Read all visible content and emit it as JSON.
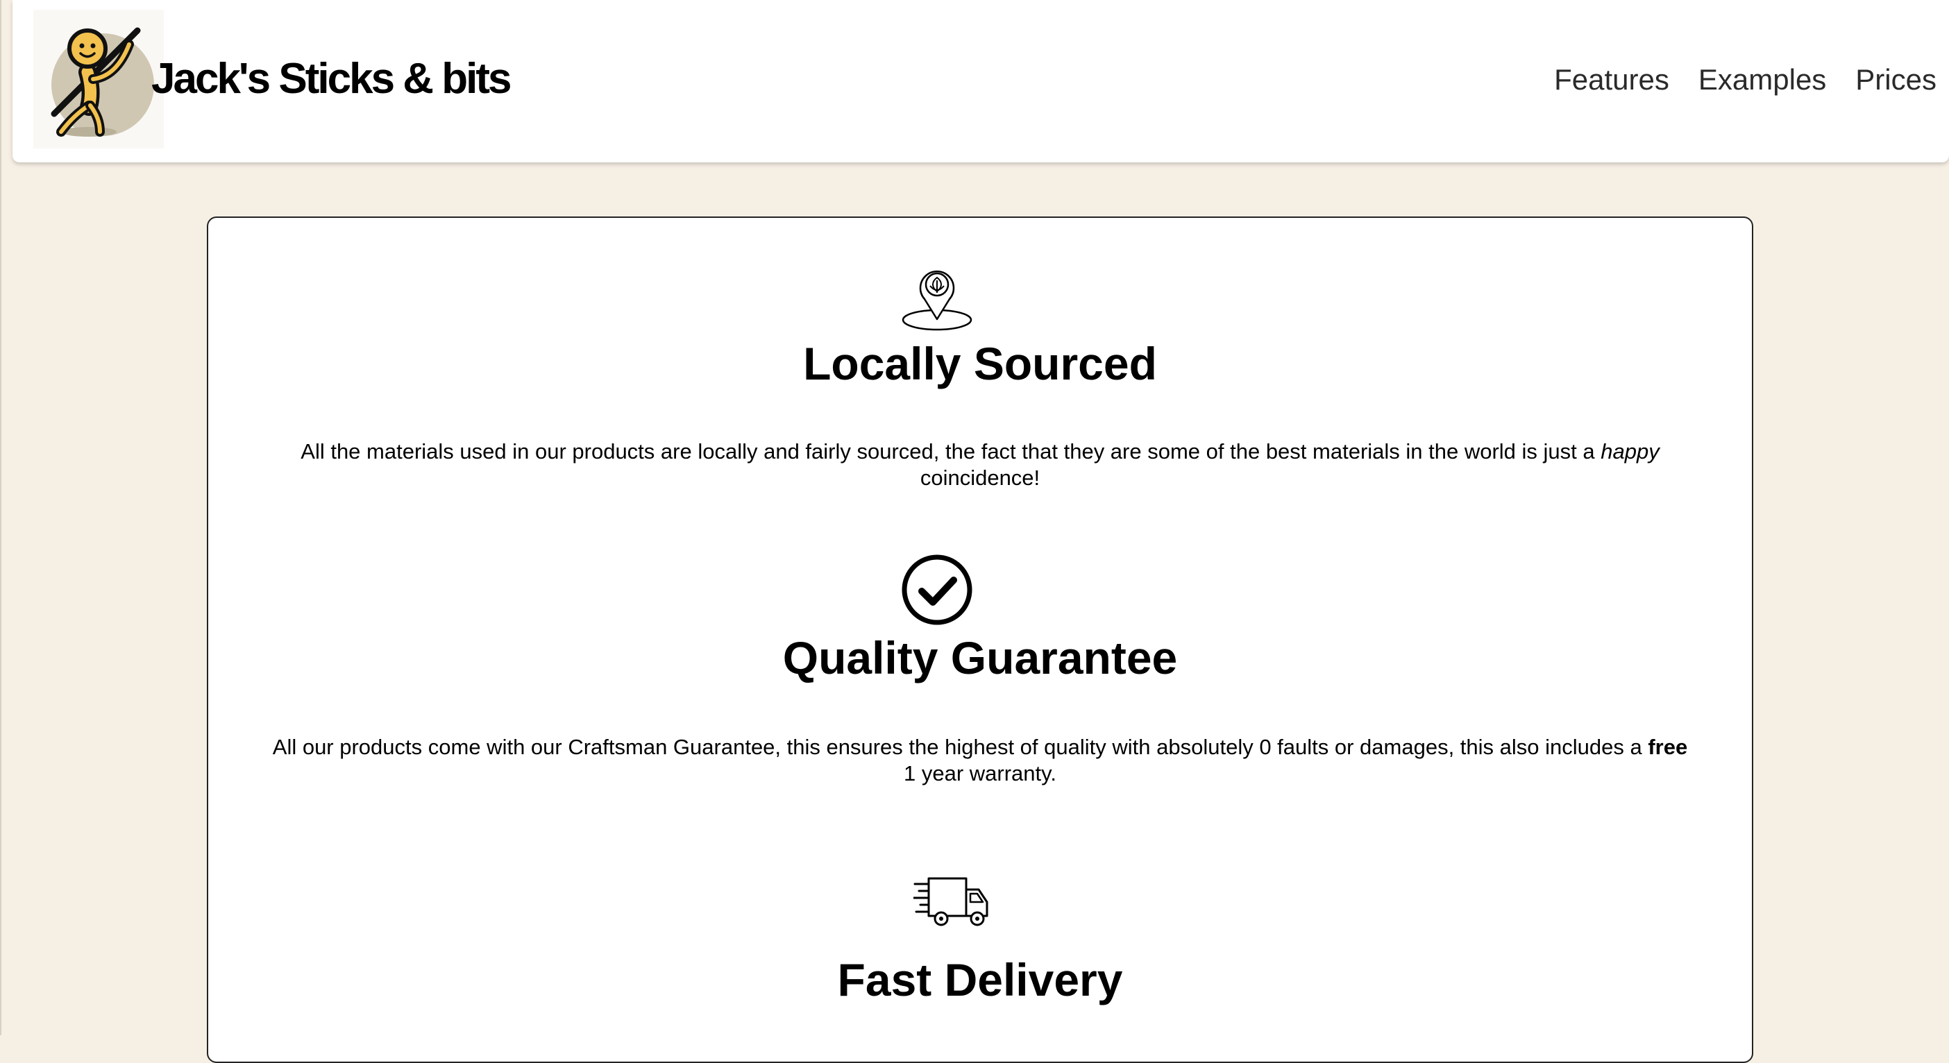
{
  "header": {
    "brand": "Jack's Sticks & bits",
    "logo_icon": "stick-figure-mascot-icon",
    "nav": [
      {
        "label": "Features"
      },
      {
        "label": "Examples"
      },
      {
        "label": "Prices"
      }
    ]
  },
  "features": [
    {
      "icon": "location-leaf-pin-icon",
      "title": "Locally Sourced",
      "text_before": "All the materials used in our products are locally and fairly sourced, the fact that they are some of the best materials in the world is just a",
      "text_emphasis": "happy",
      "text_after": "coincidence!"
    },
    {
      "icon": "check-circle-icon",
      "title": "Quality Guarantee",
      "text_before": "All our products come with our Craftsman Guarantee, this ensures the highest of quality with absolutely 0 faults or damages, this also includes a",
      "text_emphasis": "free",
      "text_after": "1 year warranty."
    },
    {
      "icon": "fast-delivery-truck-icon",
      "title": "Fast Delivery"
    }
  ],
  "colors": {
    "page_background": "#f6efe4",
    "card_background": "#ffffff",
    "mascot_yellow": "#f2c14e",
    "mascot_shadow": "#c9c0a6"
  }
}
